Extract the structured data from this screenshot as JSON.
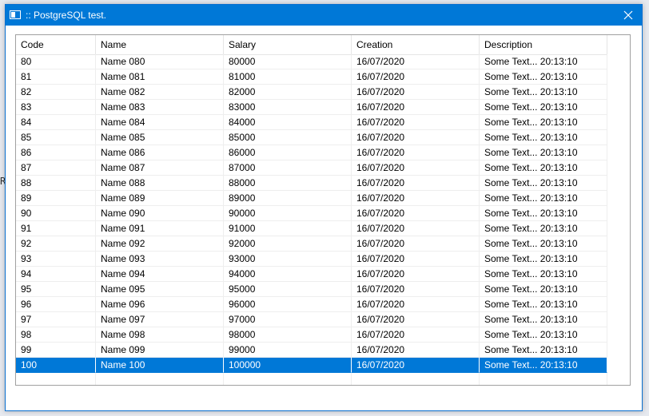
{
  "background": {
    "glyph": "R"
  },
  "window": {
    "title": ":: PostgreSQL test.",
    "icon": "app-window-icon",
    "close_icon": "close-icon",
    "accent_color": "#0078d7"
  },
  "table": {
    "columns": [
      "Code",
      "Name",
      "Salary",
      "Creation",
      "Description"
    ],
    "rows": [
      [
        "80",
        "Name 080",
        "80000",
        "16/07/2020",
        "Some Text... 20:13:10"
      ],
      [
        "81",
        "Name 081",
        "81000",
        "16/07/2020",
        "Some Text... 20:13:10"
      ],
      [
        "82",
        "Name 082",
        "82000",
        "16/07/2020",
        "Some Text... 20:13:10"
      ],
      [
        "83",
        "Name 083",
        "83000",
        "16/07/2020",
        "Some Text... 20:13:10"
      ],
      [
        "84",
        "Name 084",
        "84000",
        "16/07/2020",
        "Some Text... 20:13:10"
      ],
      [
        "85",
        "Name 085",
        "85000",
        "16/07/2020",
        "Some Text... 20:13:10"
      ],
      [
        "86",
        "Name 086",
        "86000",
        "16/07/2020",
        "Some Text... 20:13:10"
      ],
      [
        "87",
        "Name 087",
        "87000",
        "16/07/2020",
        "Some Text... 20:13:10"
      ],
      [
        "88",
        "Name 088",
        "88000",
        "16/07/2020",
        "Some Text... 20:13:10"
      ],
      [
        "89",
        "Name 089",
        "89000",
        "16/07/2020",
        "Some Text... 20:13:10"
      ],
      [
        "90",
        "Name 090",
        "90000",
        "16/07/2020",
        "Some Text... 20:13:10"
      ],
      [
        "91",
        "Name 091",
        "91000",
        "16/07/2020",
        "Some Text... 20:13:10"
      ],
      [
        "92",
        "Name 092",
        "92000",
        "16/07/2020",
        "Some Text... 20:13:10"
      ],
      [
        "93",
        "Name 093",
        "93000",
        "16/07/2020",
        "Some Text... 20:13:10"
      ],
      [
        "94",
        "Name 094",
        "94000",
        "16/07/2020",
        "Some Text... 20:13:10"
      ],
      [
        "95",
        "Name 095",
        "95000",
        "16/07/2020",
        "Some Text... 20:13:10"
      ],
      [
        "96",
        "Name 096",
        "96000",
        "16/07/2020",
        "Some Text... 20:13:10"
      ],
      [
        "97",
        "Name 097",
        "97000",
        "16/07/2020",
        "Some Text... 20:13:10"
      ],
      [
        "98",
        "Name 098",
        "98000",
        "16/07/2020",
        "Some Text... 20:13:10"
      ],
      [
        "99",
        "Name 099",
        "99000",
        "16/07/2020",
        "Some Text... 20:13:10"
      ],
      [
        "100",
        "Name 100",
        "100000",
        "16/07/2020",
        "Some Text... 20:13:10"
      ]
    ],
    "selected_row": 20,
    "selection_color": "#0078d7"
  }
}
